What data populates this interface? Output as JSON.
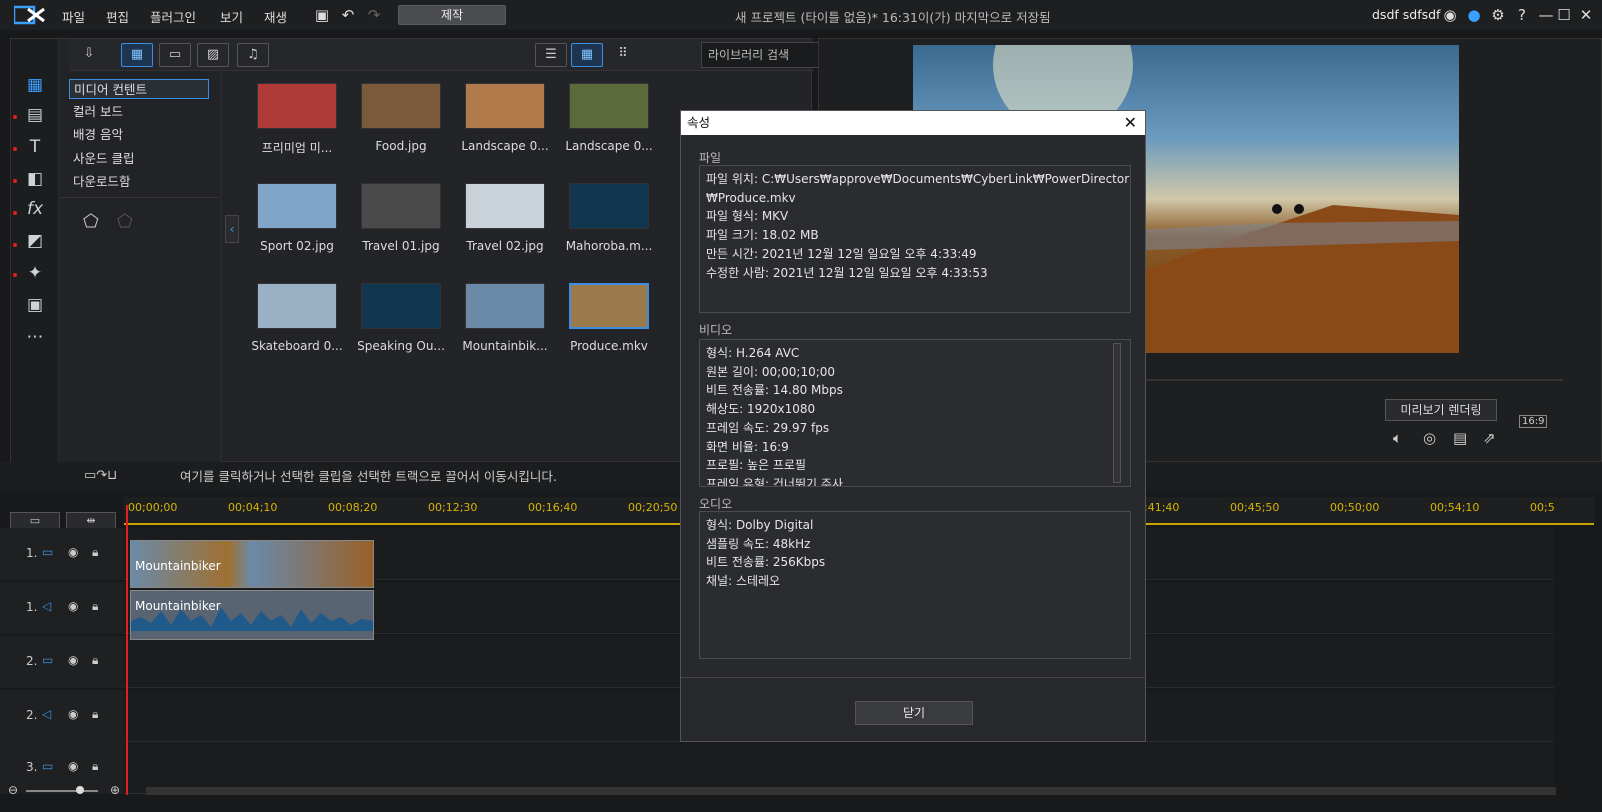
{
  "menu": [
    "파일",
    "편집",
    "플러그인",
    "보기",
    "재생"
  ],
  "produce_label": "제작",
  "project_title": "새 프로젝트 (타이틀 없음)* 16:31이(가) 마지막으로 저장됨",
  "user_name": "dsdf sdfsdf",
  "search_placeholder": "라이브러리 검색",
  "categories": [
    "미디어 컨텐트",
    "컬러 보드",
    "배경 음악",
    "사운드 클립",
    "다운로드함"
  ],
  "media": [
    {
      "label": "프리미엄 미...",
      "color": "#b03a38"
    },
    {
      "label": "Food.jpg",
      "color": "#7a5a3a"
    },
    {
      "label": "Landscape 0...",
      "color": "#b07a4a"
    },
    {
      "label": "Landscape 0...",
      "color": "#5a6a3a"
    },
    {
      "label": "Sport 02.jpg",
      "color": "#7fa6c9"
    },
    {
      "label": "Travel 01.jpg",
      "color": "#4a4a4a"
    },
    {
      "label": "Travel 02.jpg",
      "color": "#c8d2d8"
    },
    {
      "label": "Mahoroba.m...",
      "color": "#123650"
    },
    {
      "label": "Skateboard 0...",
      "color": "#9ab0c4"
    },
    {
      "label": "Speaking Ou...",
      "color": "#123650"
    },
    {
      "label": "Mountainbik...",
      "color": "#6a8aa8"
    },
    {
      "label": "Produce.mkv",
      "color": "#9a7a4a"
    }
  ],
  "preview": {
    "render_label": "미리보기 렌더링",
    "aspect": "16:9"
  },
  "timeline": {
    "hint": "여기를 클릭하거나 선택한 클립을 선택한 트랙으로 끌어서 이동시킵니다.",
    "ticks": [
      "00;00;00",
      "00;04;10",
      "00;08;20",
      "00;12;30",
      "00;16;40",
      "00;20;50",
      "00;41;40",
      "00;45;50",
      "00;50;00",
      "00;54;10",
      "00;5"
    ],
    "tracks": [
      "1.",
      "1.",
      "2.",
      "2.",
      "3."
    ],
    "clip_video": "Mountainbiker",
    "clip_audio": "Mountainbiker"
  },
  "dialog": {
    "title": "속성",
    "close": "닫기",
    "file_label": "파일",
    "file_lines": [
      "파일 위치: C:₩Users₩approve₩Documents₩CyberLink₩PowerDirector",
      "₩Produce.mkv",
      "파일 형식: MKV",
      "파일 크기: 18.02 MB",
      "만든 시간: 2021년 12월 12일 일요일 오후 4:33:49",
      "수정한 사람: 2021년 12월 12일 일요일 오후 4:33:53"
    ],
    "video_label": "비디오",
    "video_lines": [
      "형식: H.264 AVC",
      "원본 길이: 00;00;10;00",
      "비트 전송률: 14.80 Mbps",
      "해상도: 1920x1080",
      "프레임 속도: 29.97 fps",
      "화면 비율: 16:9",
      "프로필: 높은 프로필",
      "프레임 유형: 건너뛰기 주사"
    ],
    "audio_label": "오디오",
    "audio_lines": [
      "형식: Dolby Digital",
      "샘플링 속도: 48kHz",
      "비트 전송률: 256Kbps",
      "채널: 스테레오"
    ]
  }
}
